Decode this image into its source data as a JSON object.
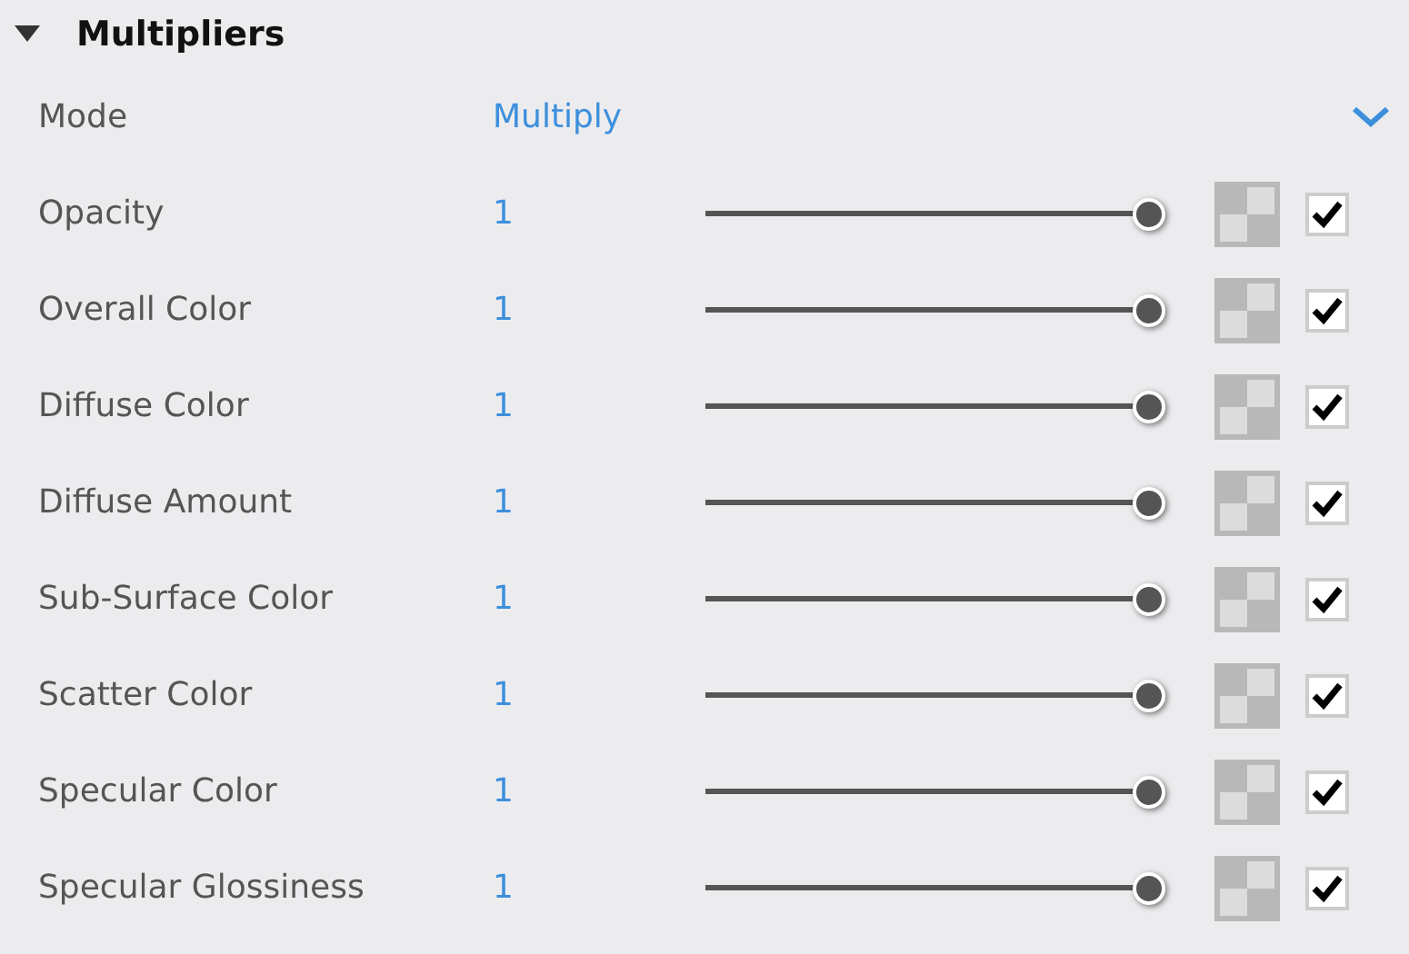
{
  "section": {
    "title": "Multipliers",
    "expanded": true
  },
  "mode": {
    "label": "Mode",
    "value": "Multiply"
  },
  "rows": [
    {
      "label": "Opacity",
      "value": "1",
      "level": 1,
      "checked": true
    },
    {
      "label": "Overall Color",
      "value": "1",
      "level": 1,
      "checked": true
    },
    {
      "label": "Diffuse Color",
      "value": "1",
      "level": 1,
      "checked": true
    },
    {
      "label": "Diffuse Amount",
      "value": "1",
      "level": 1,
      "checked": true
    },
    {
      "label": "Sub-Surface Color",
      "value": "1",
      "level": 1,
      "checked": true
    },
    {
      "label": "Scatter Color",
      "value": "1",
      "level": 1,
      "checked": true
    },
    {
      "label": "Specular Color",
      "value": "1",
      "level": 1,
      "checked": true
    },
    {
      "label": "Specular Glossiness",
      "value": "1",
      "level": 1,
      "checked": true
    }
  ]
}
